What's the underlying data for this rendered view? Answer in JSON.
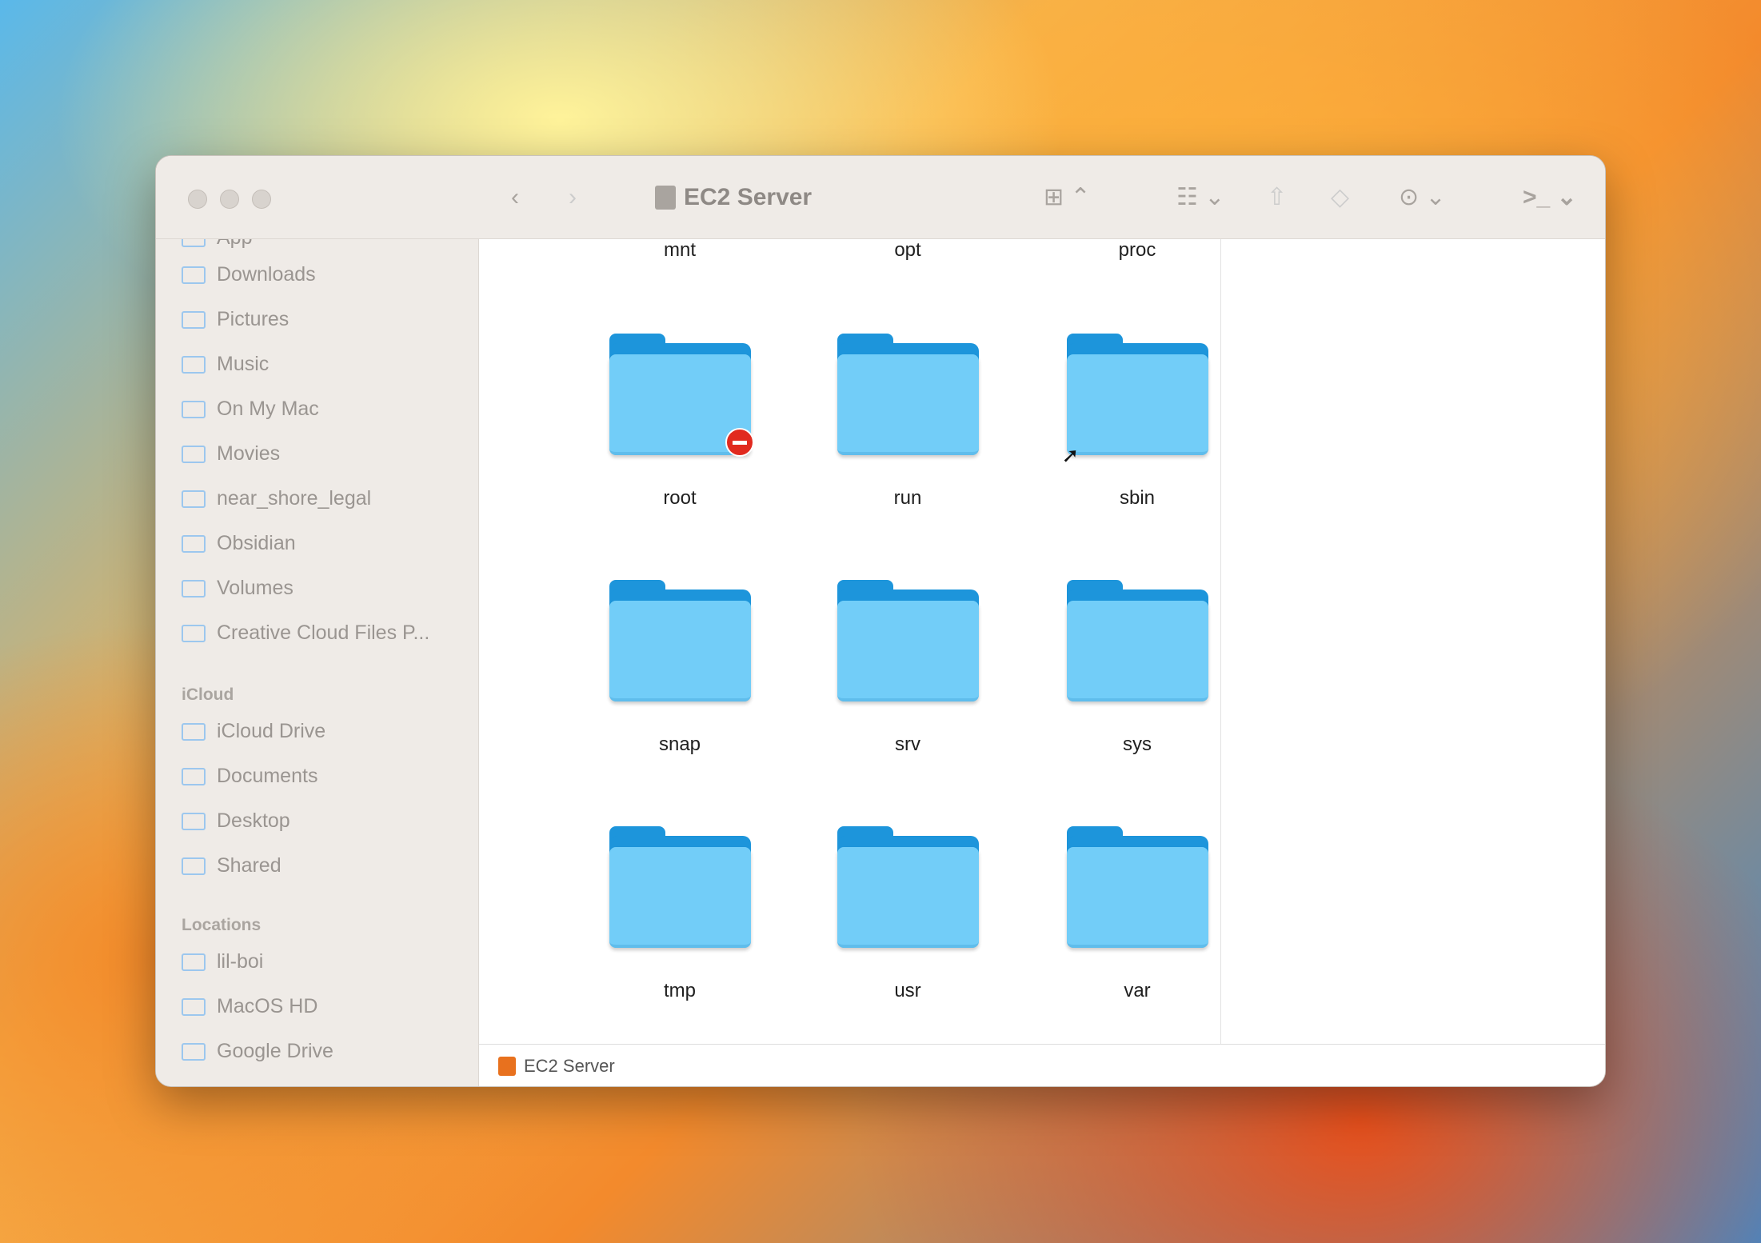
{
  "window": {
    "title": "EC2 Server"
  },
  "toolbar": {
    "back": "‹",
    "forward": "›",
    "view_icon": "⊞ ⌃",
    "group_icon": "☷ ⌄",
    "share_icon": "⇧",
    "tag_icon": "◇",
    "more_icon": "⊙ ⌄",
    "terminal_icon": ">_ ⌄",
    "overflow": "»",
    "search_icon": "⌕"
  },
  "sidebar": {
    "partial_item": "App",
    "favorites": [
      {
        "label": "Downloads",
        "icon": "folder-icon"
      },
      {
        "label": "Pictures",
        "icon": "pictures-icon"
      },
      {
        "label": "Music",
        "icon": "music-icon"
      },
      {
        "label": "On My Mac",
        "icon": "folder-icon"
      },
      {
        "label": "Movies",
        "icon": "movies-icon"
      },
      {
        "label": "near_shore_legal",
        "icon": "folder-icon"
      },
      {
        "label": "Obsidian",
        "icon": "folder-icon"
      },
      {
        "label": "Volumes",
        "icon": "folder-icon"
      },
      {
        "label": "Creative Cloud Files P...",
        "icon": "folder-icon"
      }
    ],
    "icloud_header": "iCloud",
    "icloud": [
      {
        "label": "iCloud Drive",
        "icon": "cloud-icon"
      },
      {
        "label": "Documents",
        "icon": "document-icon"
      },
      {
        "label": "Desktop",
        "icon": "desktop-icon"
      },
      {
        "label": "Shared",
        "icon": "shared-folder-icon"
      }
    ],
    "locations_header": "Locations",
    "locations": [
      {
        "label": "lil-boi",
        "icon": "laptop-icon"
      },
      {
        "label": "MacOS HD",
        "icon": "disk-icon"
      },
      {
        "label": "Google Drive",
        "icon": "google-drive-icon"
      }
    ]
  },
  "files": {
    "partial_row": [
      "mnt",
      "opt",
      "proc"
    ],
    "items": [
      {
        "name": "root",
        "badge": "no-access"
      },
      {
        "name": "run"
      },
      {
        "name": "sbin",
        "badge": "alias"
      },
      {
        "name": "snap"
      },
      {
        "name": "srv"
      },
      {
        "name": "sys"
      },
      {
        "name": "tmp"
      },
      {
        "name": "usr"
      },
      {
        "name": "var"
      }
    ]
  },
  "status_bar": {
    "path": "EC2 Server"
  }
}
